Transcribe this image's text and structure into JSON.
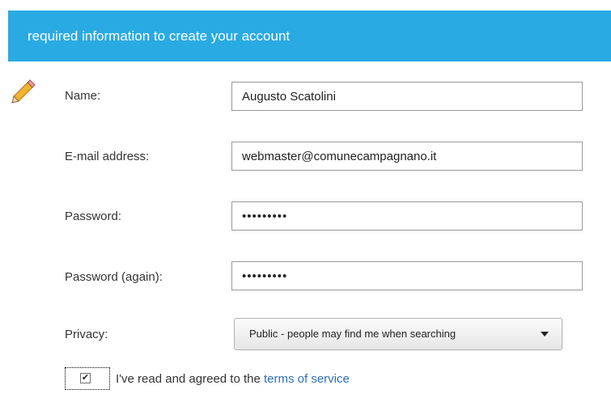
{
  "header": {
    "title": "required information to create your account"
  },
  "form": {
    "name": {
      "label": "Name:",
      "value": "Augusto Scatolini"
    },
    "email": {
      "label": "E-mail address:",
      "value": "webmaster@comunecampagnano.it"
    },
    "password": {
      "label": "Password:",
      "value": "•••••••••"
    },
    "password_again": {
      "label": "Password (again):",
      "value": "•••••••••"
    },
    "privacy": {
      "label": "Privacy:",
      "selected": "Public - people may find me when searching"
    },
    "terms": {
      "text": "I've read and agreed to the ",
      "link": "terms of service",
      "checked": true
    }
  },
  "icons": {
    "pencil": "pencil-icon",
    "dropdown": "chevron-down-icon",
    "check": "checkmark-icon"
  },
  "colors": {
    "header_bg": "#2aaae2",
    "link": "#2d6fb4"
  }
}
